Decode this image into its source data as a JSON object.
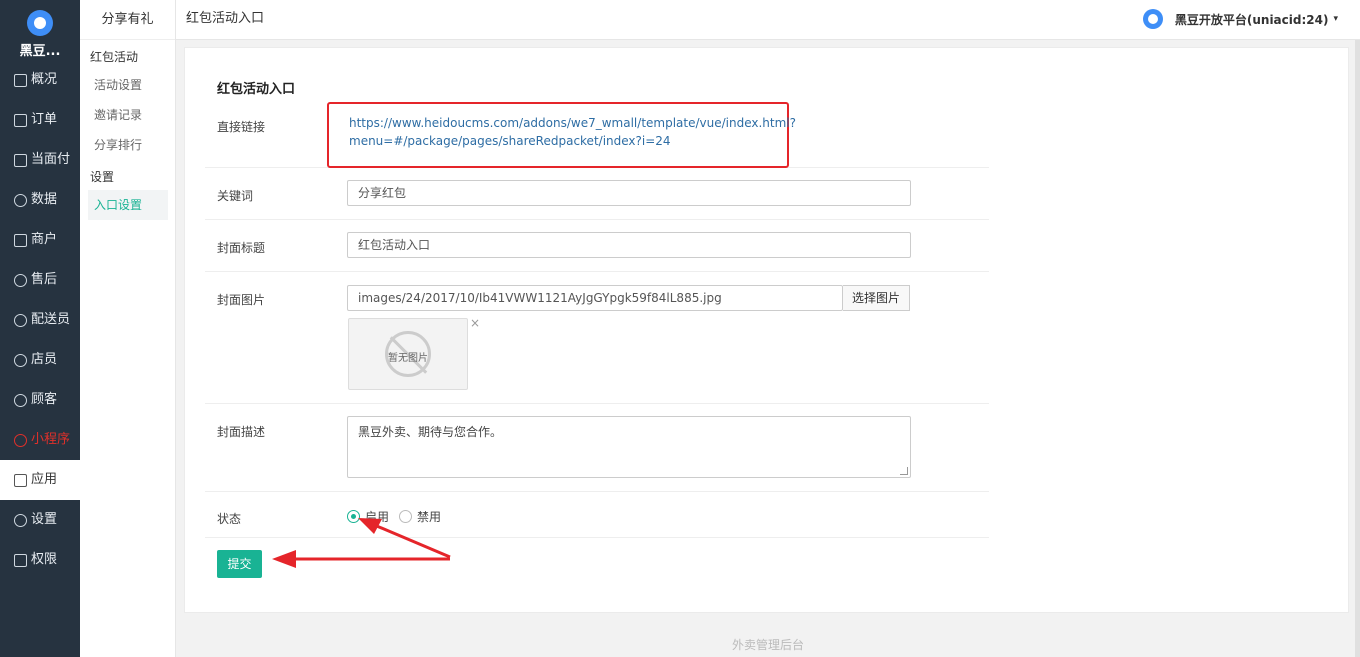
{
  "app": {
    "logo_text": "黑豆..."
  },
  "nav": {
    "items": [
      {
        "label": "概况",
        "icon": "overview-icon"
      },
      {
        "label": "订单",
        "icon": "order-icon"
      },
      {
        "label": "当面付",
        "icon": "pay-icon"
      },
      {
        "label": "数据",
        "icon": "data-icon"
      },
      {
        "label": "商户",
        "icon": "store-icon"
      },
      {
        "label": "售后",
        "icon": "aftersale-icon"
      },
      {
        "label": "配送员",
        "icon": "courier-icon"
      },
      {
        "label": "店员",
        "icon": "clerk-icon"
      },
      {
        "label": "顾客",
        "icon": "customer-icon"
      },
      {
        "label": "小程序",
        "icon": "miniprogram-icon"
      },
      {
        "label": "应用",
        "icon": "apps-icon"
      },
      {
        "label": "设置",
        "icon": "gear-icon"
      },
      {
        "label": "权限",
        "icon": "lock-icon"
      }
    ],
    "active_index": 10,
    "highlight_index": 9,
    "highlight_color": "#e0302a"
  },
  "subnav": {
    "title": "分享有礼",
    "group1": "红包活动",
    "links1": [
      "活动设置",
      "邀请记录",
      "分享排行"
    ],
    "group2": "设置",
    "links2": [
      "入口设置"
    ]
  },
  "topbar": {
    "breadcrumb": "红包活动入口",
    "user": "黑豆开放平台(uniacid:24)",
    "caret": "▾"
  },
  "form": {
    "title": "红包活动入口",
    "direct_link_label": "直接链接",
    "direct_link_line1": "https://www.heidoucms.com/addons/we7_wmall/template/vue/index.html?",
    "direct_link_line2": "menu=#/package/pages/shareRedpacket/index?i=24",
    "keyword_label": "关键词",
    "keyword_value": "分享红包",
    "cover_title_label": "封面标题",
    "cover_title_value": "红包活动入口",
    "cover_image_label": "封面图片",
    "cover_image_value": "images/24/2017/10/Ib41VWW1121AyJgGYpgk59f84lL885.jpg",
    "pick_image_button": "选择图片",
    "no_image_text": "暂无图片",
    "remove_image": "×",
    "cover_desc_label": "封面描述",
    "cover_desc_value": "黑豆外卖、期待与您合作。",
    "status_label": "状态",
    "status_options": [
      "启用",
      "禁用"
    ],
    "status_selected": "启用",
    "submit": "提交"
  },
  "footer": "外卖管理后台",
  "colors": {
    "accent": "#19b394",
    "sidebar": "#263340",
    "annotation": "#e5252a"
  }
}
